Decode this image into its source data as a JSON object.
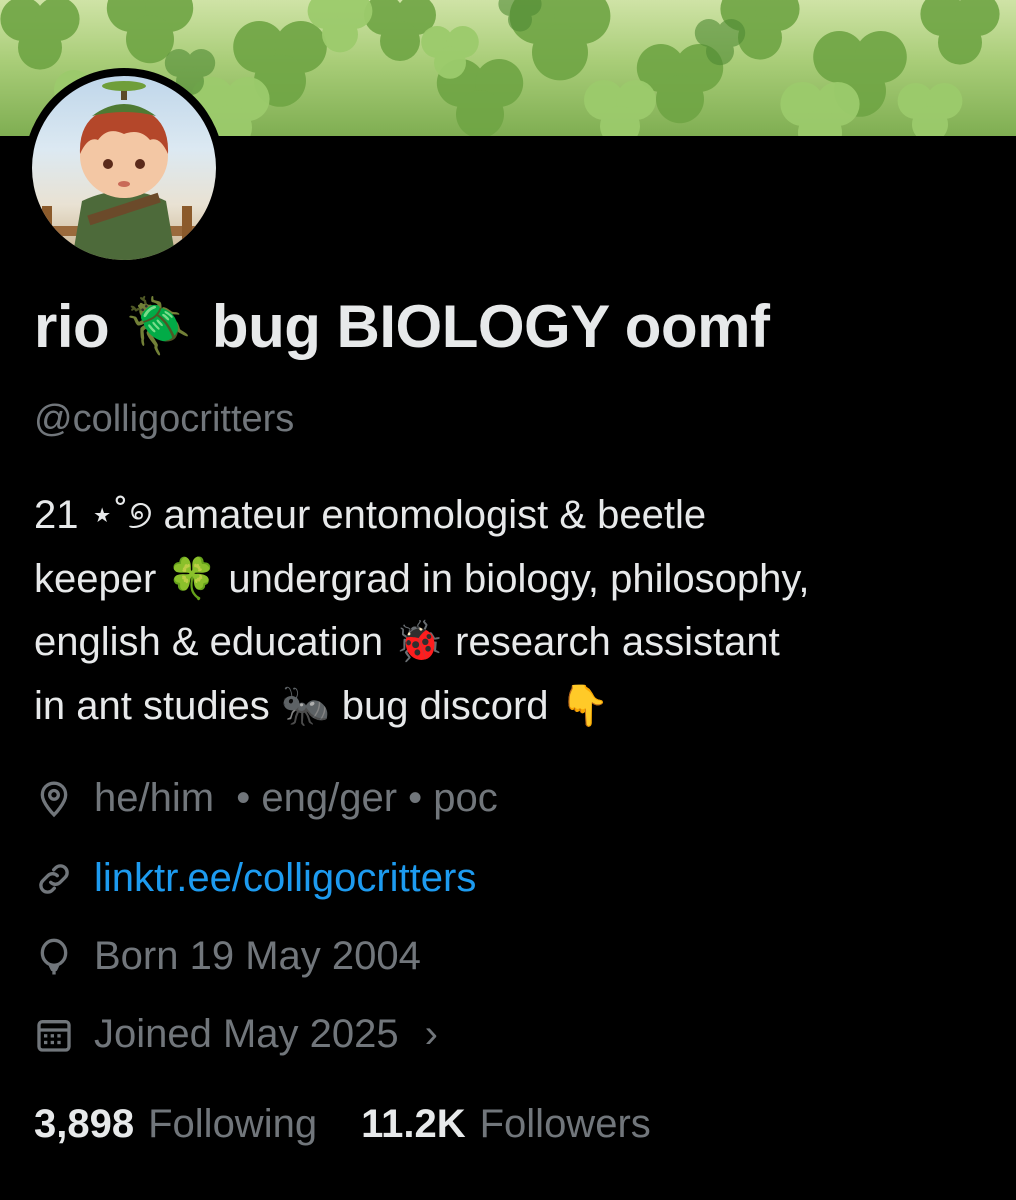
{
  "profile": {
    "display_name_prefix": "rio",
    "name_emoji": "🪲",
    "display_name_suffix": "bug BIOLOGY oomf",
    "handle": "@colligocritters",
    "bio_lines": [
      "21 ⋆˚୭ amateur entomologist & beetle",
      "keeper 🍀 undergrad in biology, philosophy,",
      "english & education 🐞 research assistant",
      "in ant studies 🐜 bug discord 👇"
    ],
    "location": "he/him  • eng/ger • poc",
    "website": "linktr.ee/colligocritters",
    "birth": "Born 19 May 2004",
    "joined": "Joined May 2025",
    "joined_chevron": "›",
    "following_count": "3,898",
    "following_label": "Following",
    "followers_count": "11.2K",
    "followers_label": "Followers"
  },
  "colors": {
    "background": "#000000",
    "text_primary": "#e7e9ea",
    "text_secondary": "#71767b",
    "link": "#1d9bf0",
    "banner_green": "#8fbf5e"
  },
  "icons": {
    "location": "location-pin-icon",
    "website": "link-icon",
    "birth": "balloon-icon",
    "joined": "calendar-icon",
    "joined_more": "chevron-right-icon"
  }
}
